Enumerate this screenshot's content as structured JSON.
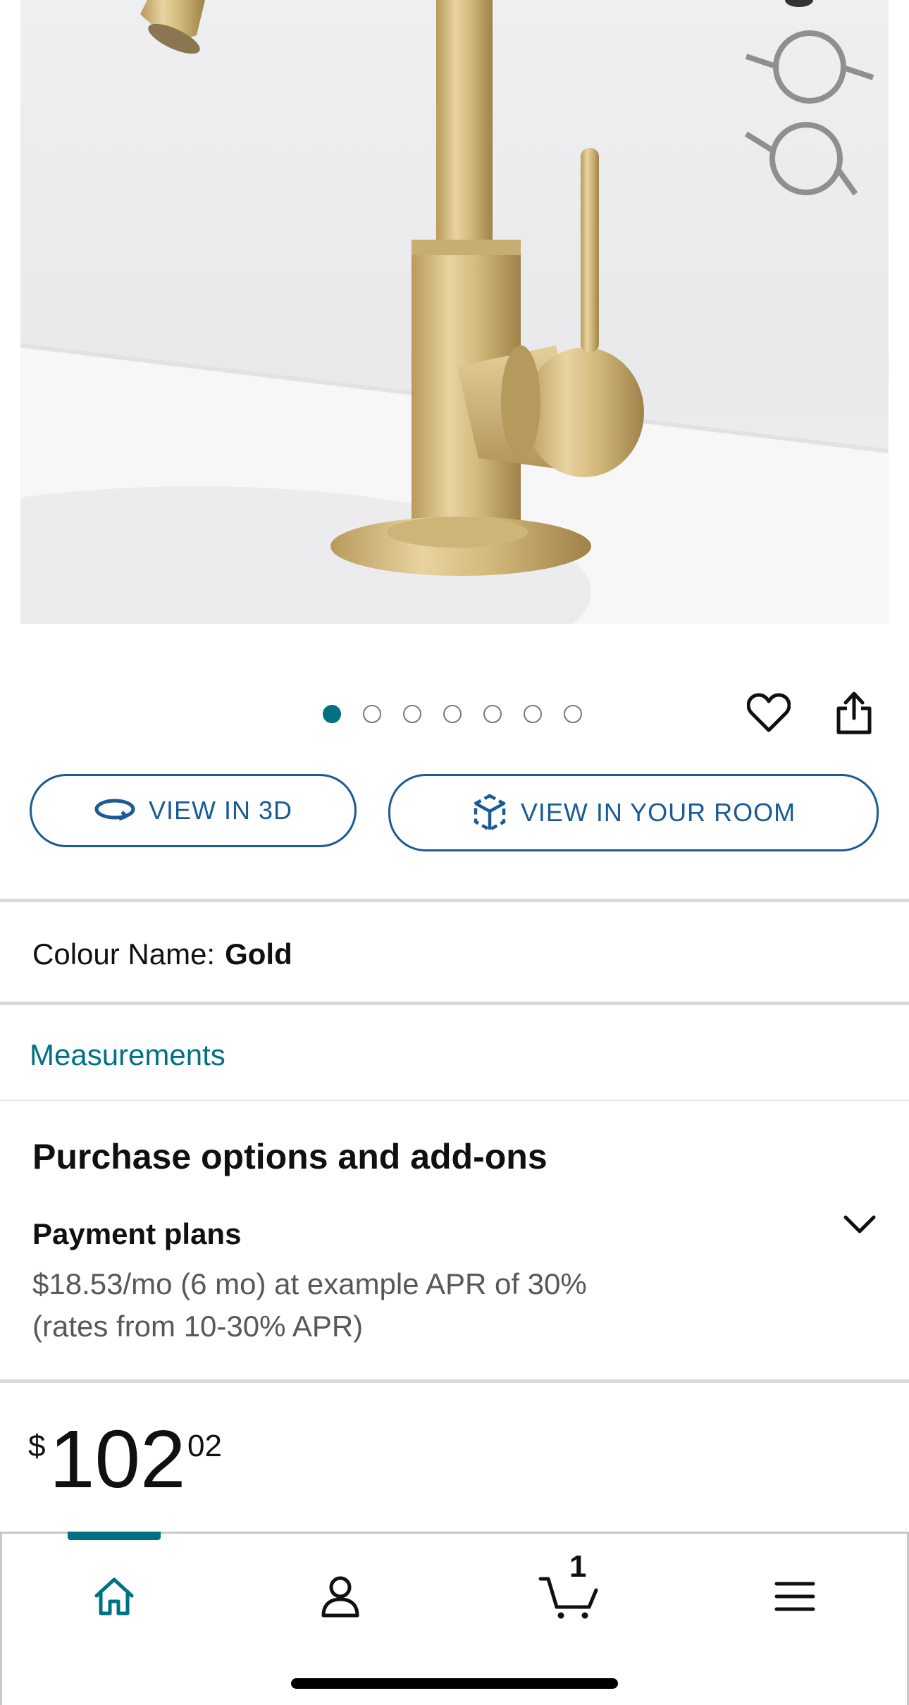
{
  "product": {
    "image_alt": "Gold bathroom faucet",
    "carousel": {
      "total": 7,
      "active_index": 0
    }
  },
  "actions": {
    "wishlist_icon": "heart-icon",
    "share_icon": "share-icon",
    "view_3d_label": "VIEW IN 3D",
    "view_room_label": "VIEW IN YOUR ROOM"
  },
  "colour": {
    "label": "Colour Name:",
    "value": "Gold"
  },
  "measurements": {
    "label": "Measurements"
  },
  "purchase_options": {
    "title": "Purchase options and add-ons",
    "payment_plans": {
      "title": "Payment plans",
      "line1": "$18.53/mo (6 mo) at example APR of 30%",
      "line2": "(rates from 10-30% APR)"
    }
  },
  "price": {
    "symbol": "$",
    "whole": "102",
    "fraction": "02"
  },
  "bottom_nav": {
    "items": [
      "home-icon",
      "account-icon",
      "cart-icon",
      "menu-icon"
    ],
    "cart_count": "1",
    "active": "home",
    "accent": "#007185"
  },
  "colors": {
    "link": "#007185",
    "button_border": "#1a5a96",
    "text": "#0f1111",
    "muted": "#565959"
  }
}
